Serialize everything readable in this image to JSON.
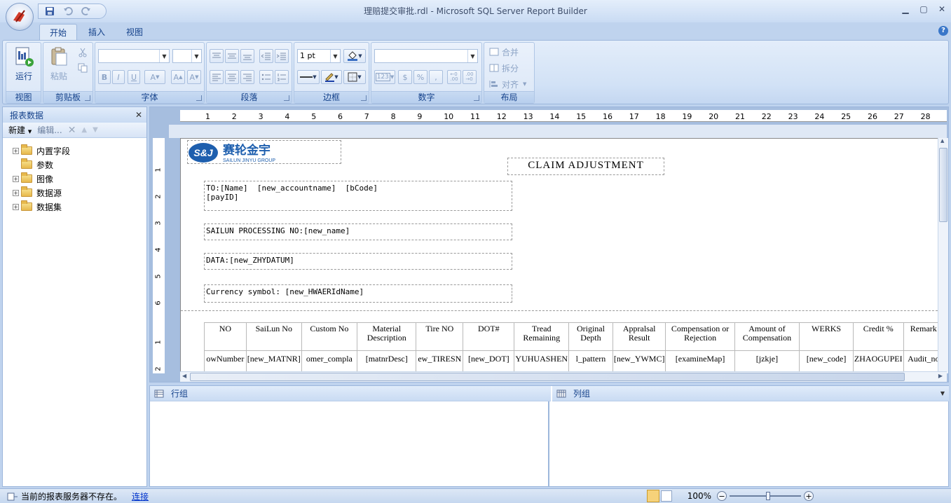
{
  "window": {
    "title": "理赔提交审批.rdl - Microsoft SQL Server Report Builder",
    "minimize": "▁",
    "maximize": "▢",
    "close": "✕"
  },
  "tabs": [
    {
      "label": "开始",
      "active": true
    },
    {
      "label": "插入",
      "active": false
    },
    {
      "label": "视图",
      "active": false
    }
  ],
  "ribbon": {
    "view_group": {
      "label": "视图",
      "run_label": "运行"
    },
    "clipboard_group": {
      "label": "剪贴板",
      "paste_label": "粘贴"
    },
    "font_group": {
      "label": "字体",
      "font_name": "",
      "font_size": "",
      "bold": "B",
      "italic": "I",
      "underline": "U",
      "font_color": "A",
      "grow": "A",
      "shrink": "A"
    },
    "paragraph_group": {
      "label": "段落"
    },
    "border_group": {
      "label": "边框",
      "border_width": "1 pt"
    },
    "number_group": {
      "label": "数字",
      "format_value": "",
      "placeholder": "123",
      "currency": "$",
      "percent": "%",
      "comma": ",",
      "inc_decimal": "←0\n.00",
      "dec_decimal": ".00\n→0"
    },
    "layout_group": {
      "label": "布局",
      "merge": "合并",
      "split": "拆分",
      "align": "对齐"
    }
  },
  "left_panel": {
    "title": "报表数据",
    "close": "✕",
    "new_label": "新建",
    "edit_label": "编辑...",
    "tree": [
      {
        "label": "内置字段",
        "expandable": true
      },
      {
        "label": "参数",
        "expandable": false
      },
      {
        "label": "图像",
        "expandable": true
      },
      {
        "label": "数据源",
        "expandable": true
      },
      {
        "label": "数据集",
        "expandable": true
      }
    ]
  },
  "ruler": {
    "h": [
      "1",
      "2",
      "3",
      "4",
      "5",
      "6",
      "7",
      "8",
      "9",
      "10",
      "11",
      "12",
      "13",
      "14",
      "15",
      "16",
      "17",
      "18",
      "19",
      "20",
      "21",
      "22",
      "23",
      "24",
      "25",
      "26",
      "27",
      "28"
    ],
    "v": [
      "1",
      "2",
      "3",
      "4",
      "5",
      "6",
      "1",
      "2"
    ]
  },
  "report": {
    "logo_text": "赛轮金宇",
    "logo_sub": "SAILUN JINYU GROUP",
    "logo_mark": "S&J",
    "title": "CLAIM ADJUSTMENT",
    "to_box": "TO:[Name]  [new_accountname]  [bCode]\n[payID]",
    "processing_box": "SAILUN PROCESSING NO:[new_name]",
    "data_box": "DATA:[new_ZHYDATUM]",
    "currency_box": "Currency symbol: [new_HWAERIdName]",
    "table_headers": [
      "NO",
      "SaiLun No",
      "Custom No",
      "Material Description",
      "Tire NO",
      "DOT#",
      "Tread Remaining",
      "Original Depth",
      "Appralsal Result",
      "Compensation or Rejection",
      "Amount of Compensation",
      "WERKS",
      "Credit %",
      "Remark"
    ],
    "table_row": [
      "owNumber",
      "[new_MATNR]",
      "omer_compla",
      "[matnrDesc]",
      "ew_TIRESN",
      "[new_DOT]",
      "YUHUASHEN",
      "l_pattern",
      "[new_YWMC]",
      "[examineMap]",
      "[jzkje]",
      "[new_code]",
      "ZHAOGUPEI",
      "Audit_no"
    ]
  },
  "groups": {
    "row_group": "行组",
    "col_group": "列组"
  },
  "status": {
    "message": "当前的报表服务器不存在。",
    "link": "连接",
    "zoom": "100%",
    "zoom_minus": "−",
    "zoom_plus": "+"
  },
  "colors": {
    "accent": "#15428b",
    "ribbon_bg": "#d2e2f6"
  }
}
